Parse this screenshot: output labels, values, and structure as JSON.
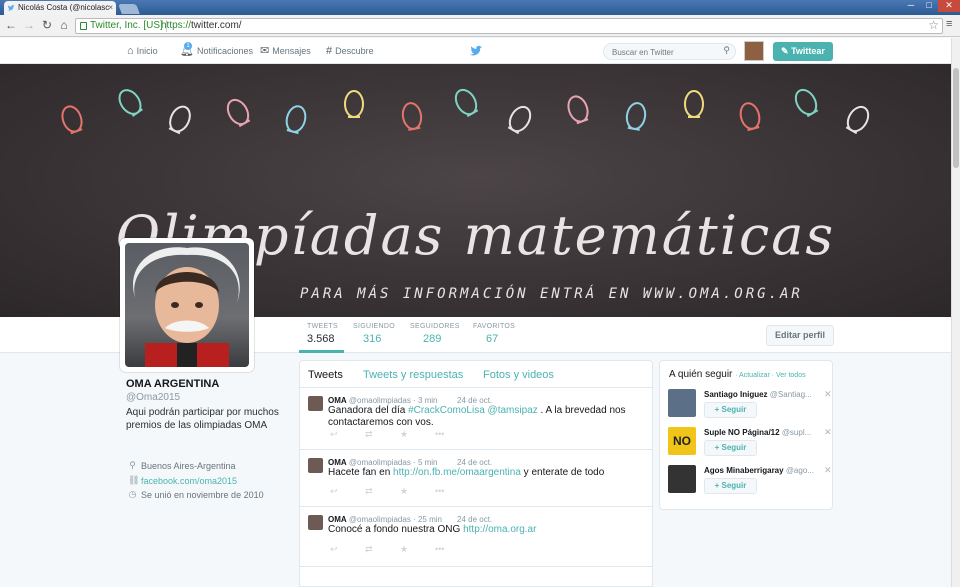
{
  "browser": {
    "tab_title": "Nicolás Costa (@nicolasc",
    "tab_close": "×",
    "ev_label": "Twitter, Inc. [US]",
    "url_scheme": "https://",
    "url_rest": "twitter.com/",
    "win_min": "─",
    "win_max": "□",
    "win_close": "✕"
  },
  "topnav": {
    "home": "Inicio",
    "notifications": "Notificaciones",
    "notifications_count": "1",
    "messages": "Mensajes",
    "discover": "Descubre",
    "search_placeholder": "Buscar en Twitter",
    "tweet_button": "Twittear"
  },
  "banner": {
    "title": "Olimpíadas matemáticas",
    "subtitle": "PARA MÁS INFORMACIÓN ENTRÁ EN WWW.OMA.ORG.AR"
  },
  "stats": [
    {
      "label": "TWEETS",
      "value": "3.568"
    },
    {
      "label": "SIGUIENDO",
      "value": "316"
    },
    {
      "label": "SEGUIDORES",
      "value": "289"
    },
    {
      "label": "FAVORITOS",
      "value": "67"
    }
  ],
  "edit_profile": "Editar perfil",
  "profile": {
    "name": "OMA ARGENTINA",
    "handle": "@Oma2015",
    "bio": "Aqui podrán participar por muchos premios de las olimpiadas OMA",
    "location": "Buenos Aires-Argentina",
    "website": "facebook.com/oma2015",
    "joined": "Se unió en noviembre de 2010"
  },
  "timeline_tabs": [
    "Tweets",
    "Tweets y respuestas",
    "Fotos y videos"
  ],
  "tweets": [
    {
      "name": "OMA",
      "handle_time": "@omaolimpiadas · 3 min",
      "date": "24 de oct.",
      "text_before": "Ganadora del día ",
      "link1": "#CrackComoLisa",
      "text_mid": " ",
      "link2": "@tamsipaz",
      "text_after": " . A la brevedad nos contactaremos con vos."
    },
    {
      "name": "OMA",
      "handle_time": "@omaolimpiadas · 5 min",
      "date": "24 de oct.",
      "text_before": "Hacete fan en ",
      "link1": "http://on.fb.me/omaargentina",
      "text_after": " y enterate de todo"
    },
    {
      "name": "OMA",
      "handle_time": "@omaolimpiadas · 25 min",
      "date": "24 de oct.",
      "text_before": "Conocé a fondo nuestra ONG ",
      "link1": "http://oma.org.ar",
      "text_after": ""
    }
  ],
  "who_to_follow": {
    "title": "A quién seguir",
    "refresh": "· Actualizar · Ver todos",
    "follow_label": "Seguir",
    "items": [
      {
        "name": "Santiago Iniguez",
        "handle": "@Santiag..."
      },
      {
        "name": "Suple NO Página/12",
        "handle": "@supl..."
      },
      {
        "name": "Agos Minaberrigaray",
        "handle": "@ago..."
      }
    ]
  },
  "colors": {
    "accent": "#4ab3b0",
    "banner_bg": "#3a3436"
  },
  "icons": {
    "home": "house",
    "notifications": "bell",
    "messages": "envelope",
    "discover": "hash",
    "location": "pin",
    "link": "chain",
    "calendar": "clock"
  }
}
